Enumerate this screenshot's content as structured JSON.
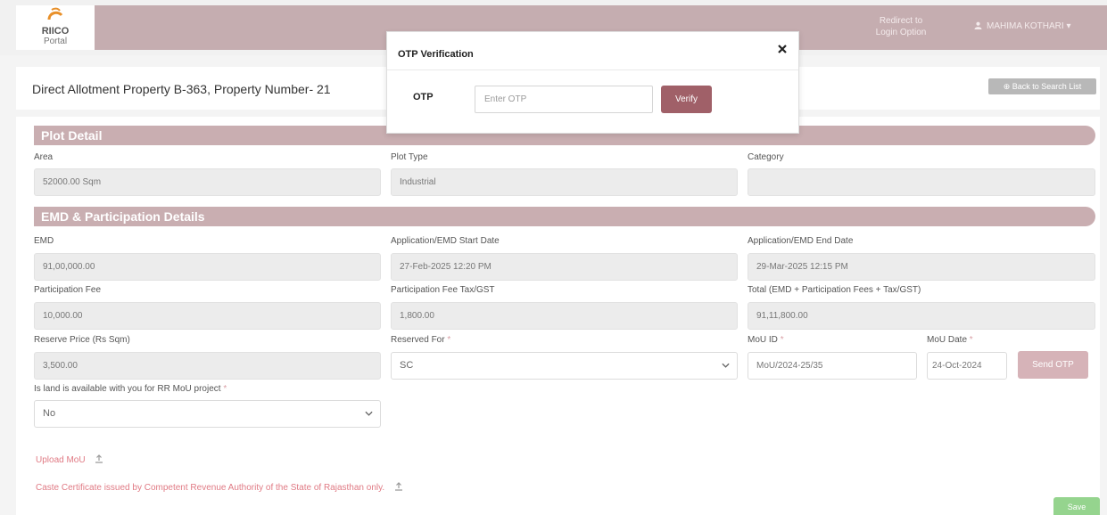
{
  "colors": {
    "topbar": "#c5adb0",
    "section_header": "#c9aeb1",
    "verify_button": "#a06068",
    "send_otp_button": "#d6b3b8",
    "link_red": "#e07a84",
    "save_button": "#95d48e"
  },
  "header": {
    "brand_name": "RIICO",
    "brand_sub": "Portal",
    "redirect_line1": "Redirect to",
    "redirect_line2": "Login Option",
    "user_icon": "user-icon",
    "user_name": "MAHIMA KOTHARI ▾"
  },
  "title_bar": {
    "title": "Direct Allotment Property B-363, Property Number- 21",
    "back_button": "Back to Search List"
  },
  "plot_detail": {
    "heading": "Plot Detail",
    "area_label": "Area",
    "area_value": "52000.00 Sqm",
    "plot_type_label": "Plot Type",
    "plot_type_value": "Industrial",
    "category_label": "Category",
    "category_value": ""
  },
  "emd": {
    "heading": "EMD & Participation Details",
    "emd_label": "EMD",
    "emd_value": "91,00,000.00",
    "start_label": "Application/EMD Start Date",
    "start_value": "27-Feb-2025 12:20 PM",
    "end_label": "Application/EMD End Date",
    "end_value": "29-Mar-2025 12:15 PM",
    "fee_label": "Participation Fee",
    "fee_value": "10,000.00",
    "fee_tax_label": "Participation Fee Tax/GST",
    "fee_tax_value": "1,800.00",
    "total_label": "Total (EMD + Participation Fees + Tax/GST)",
    "total_value": "91,11,800.00",
    "reserve_label": "Reserve Price (Rs Sqm)",
    "reserve_value": "3,500.00",
    "reserved_for_label": "Reserved For",
    "reserved_for_value": "SC",
    "mou_id_label": "MoU ID",
    "mou_id_value": "MoU/2024-25/35",
    "mou_date_label": "MoU Date",
    "mou_date_value": "24-Oct-2024",
    "send_otp": "Send OTP",
    "land_label": "Is land is available with you for RR MoU project",
    "land_value": "No",
    "required_mark": "*"
  },
  "uploads": {
    "upload_mou": "Upload MoU",
    "caste_certificate": "Caste Certificate issued by Competent Revenue Authority of the State of Rajasthan only.",
    "upload_icon": "upload-icon"
  },
  "save_button": "Save",
  "modal": {
    "title": "OTP Verification",
    "close_icon": "close-icon",
    "otp_label": "OTP",
    "otp_placeholder": "Enter OTP",
    "otp_value": "",
    "verify_button": "Verify"
  }
}
